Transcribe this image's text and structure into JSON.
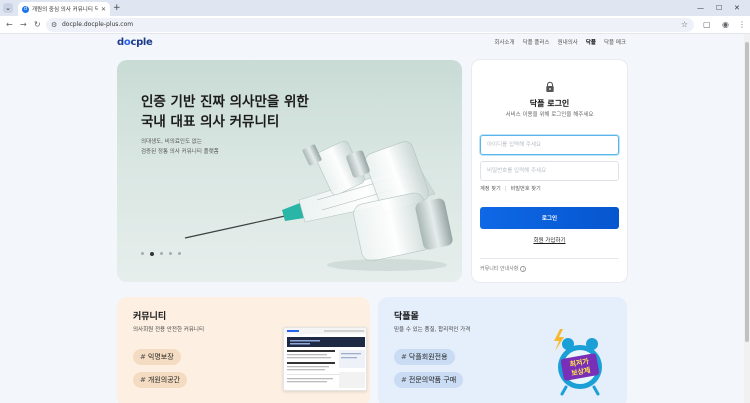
{
  "browser": {
    "tab_title": "개원의 중심 의사 커뮤니티 닥",
    "new_tab": "+",
    "url": "docple.docple-plus.com"
  },
  "site": {
    "logo_prefix": "d",
    "logo_o": "o",
    "logo_suffix": "cple",
    "nav": [
      "회사소개",
      "닥플 플러스",
      "원내의사",
      "닥플",
      "닥플 메크"
    ],
    "nav_active_index": 3
  },
  "hero": {
    "title_line1": "인증 기반 진짜 의사만을 위한",
    "title_line2": "국내 대표 의사 커뮤니티",
    "sub_line1": "의대생도, 비의료인도 없는",
    "sub_line2": "검증된 정통 의사 커뮤니티 플랫폼",
    "slide_count": 5,
    "active_slide": 1
  },
  "login": {
    "title": "닥플 로그인",
    "subtitle": "서비스 이용을 위해 로그인을 해주세요",
    "id_placeholder": "아이디를 입력해 주세요",
    "pw_placeholder": "비밀번호를 입력해 주세요",
    "find_id": "계정 찾기",
    "separator": "|",
    "find_pw": "비밀번호 찾기",
    "button": "로그인",
    "signup": "회원 가입하기",
    "guide": "커뮤니티 안내사항",
    "guide_icon": "i"
  },
  "cards": {
    "community": {
      "title": "커뮤니티",
      "subtitle": "의사회원 전용 안전한 커뮤니티",
      "tags": [
        "익명보장",
        "개원의공간"
      ]
    },
    "mall": {
      "title": "닥플몰",
      "subtitle": "믿을 수 있는 품질, 합리적인 가격",
      "tags": [
        "닥플회원전용",
        "전문의약품 구매"
      ],
      "badge_line1": "최저가",
      "badge_line2": "보상제"
    },
    "hash": "#"
  },
  "colors": {
    "primary": "#0f68e6",
    "logo": "#1e3a8a",
    "community_bg": "#fdf0e2",
    "mall_bg": "#e5eefb"
  }
}
